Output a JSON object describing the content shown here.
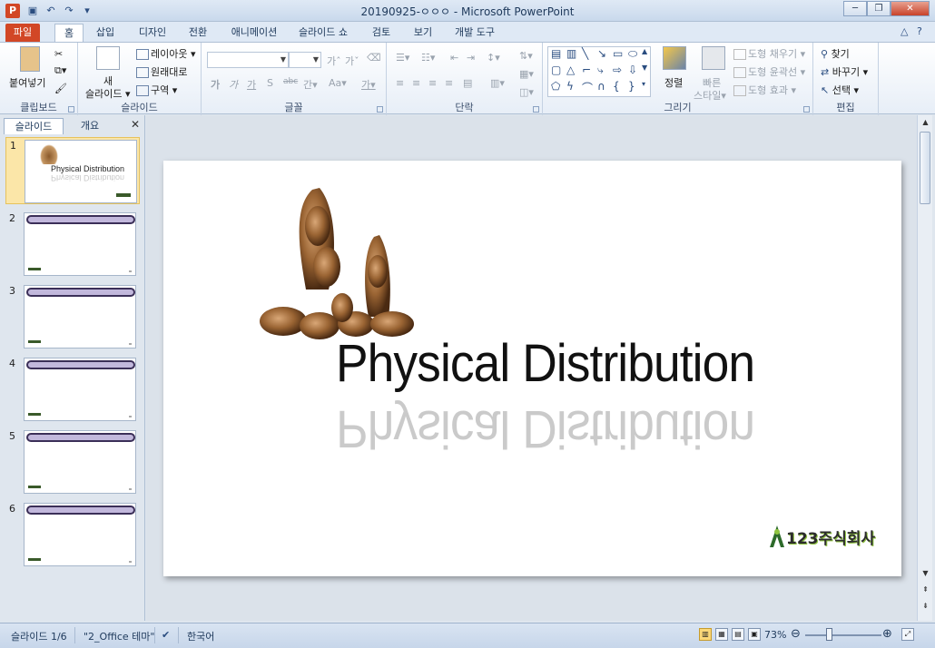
{
  "window": {
    "title": "20190925-ㅇㅇㅇ - Microsoft PowerPoint",
    "app_icon": "P"
  },
  "qat": {
    "save_icon": "save-icon",
    "undo_icon": "undo-icon",
    "redo_icon": "redo-icon"
  },
  "tabs": [
    {
      "label": "파일"
    },
    {
      "label": "홈"
    },
    {
      "label": "삽입"
    },
    {
      "label": "디자인"
    },
    {
      "label": "전환"
    },
    {
      "label": "애니메이션"
    },
    {
      "label": "슬라이드 쇼"
    },
    {
      "label": "검토"
    },
    {
      "label": "보기"
    },
    {
      "label": "개발 도구"
    }
  ],
  "ribbon": {
    "clipboard": {
      "paste": "붙여넣기",
      "label": "클립보드"
    },
    "slides": {
      "new_slide_1": "새",
      "new_slide_2": "슬라이드",
      "layout": "레이아웃",
      "reset": "원래대로",
      "section": "구역",
      "label": "슬라이드"
    },
    "font": {
      "label": "글꼴",
      "bold": "가",
      "italic": "가",
      "underline": "가",
      "shadow": "S",
      "strike": "abc",
      "spacing": "간",
      "case": "Aa",
      "color": "가",
      "grow": "가",
      "shrink": "가"
    },
    "paragraph": {
      "label": "단락"
    },
    "drawing": {
      "arrange": "정렬",
      "quick_1": "빠른",
      "quick_2": "스타일",
      "fill": "도형 채우기",
      "outline": "도형 윤곽선",
      "effects": "도형 효과",
      "label": "그리기"
    },
    "editing": {
      "find": "찾기",
      "replace": "바꾸기",
      "select": "선택",
      "label": "편집"
    }
  },
  "panel": {
    "tab_slides": "슬라이드",
    "tab_outline": "개요",
    "slides": [
      "1",
      "2",
      "3",
      "4",
      "5",
      "6"
    ]
  },
  "slide": {
    "title": "Physical Distribution",
    "company": "123주식회사"
  },
  "status": {
    "slide_pos": "슬라이드 1/6",
    "theme": "\"2_Office 테마\"",
    "language": "한국어",
    "zoom": "73%"
  },
  "colors": {
    "file_tab": "#d24726",
    "selection": "#fbe6a8",
    "accent": "#2a4d80"
  }
}
